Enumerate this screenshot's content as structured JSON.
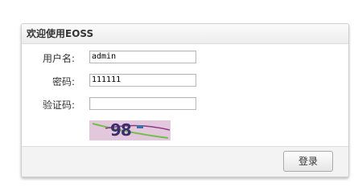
{
  "panel": {
    "title": "欢迎使用EOSS"
  },
  "form": {
    "username": {
      "label": "用户名:",
      "value": "admin"
    },
    "password": {
      "label": "密码:",
      "value": "111111"
    },
    "captcha": {
      "label": "验证码:",
      "value": "",
      "image_text": "98"
    }
  },
  "footer": {
    "login_label": "登录"
  },
  "colors": {
    "captcha_background": "#e3c7dc",
    "captcha_text": "#3b2e6e",
    "captcha_line_green": "#6fbf4a",
    "captcha_line_purple": "#8a3a8a"
  }
}
